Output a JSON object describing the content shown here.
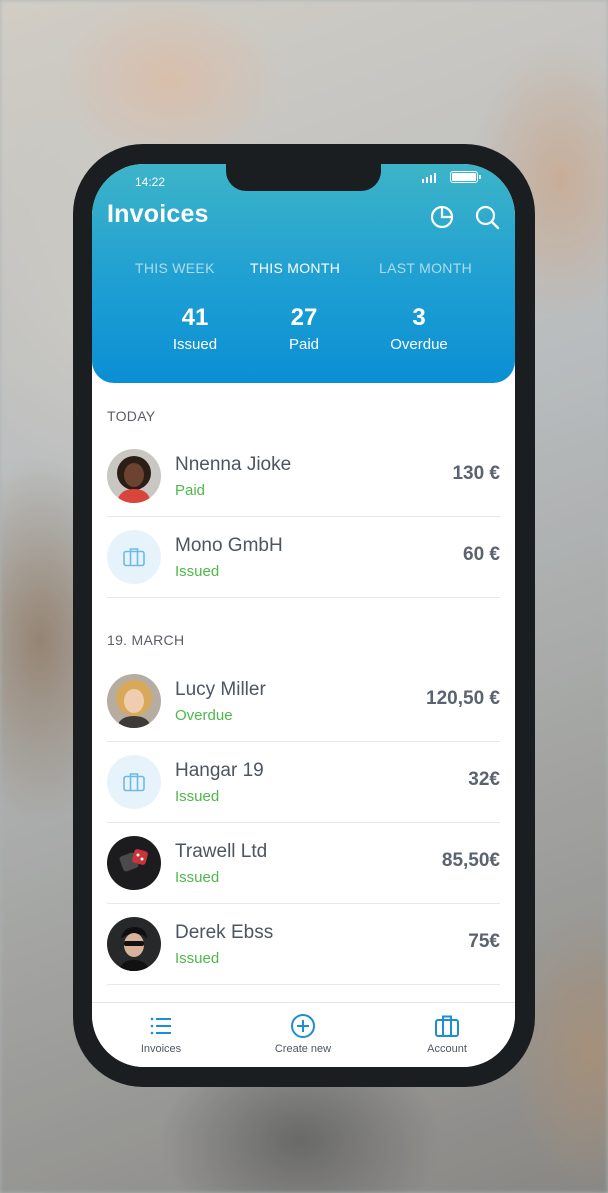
{
  "status_bar": {
    "time": "14:22"
  },
  "header": {
    "title": "Invoices",
    "tabs": [
      {
        "label": "THIS WEEK",
        "active": false
      },
      {
        "label": "THIS MONTH",
        "active": true
      },
      {
        "label": "LAST MONTH",
        "active": false
      }
    ],
    "stats": [
      {
        "value": "41",
        "label": "Issued"
      },
      {
        "value": "27",
        "label": "Paid"
      },
      {
        "value": "3",
        "label": "Overdue"
      }
    ]
  },
  "sections": [
    {
      "label": "TODAY",
      "items": [
        {
          "name": "Nnenna Jioke",
          "status": "Paid",
          "amount": "130 €",
          "avatar": "person-photo"
        },
        {
          "name": "Mono GmbH",
          "status": "Issued",
          "amount": "60 €",
          "avatar": "briefcase-icon"
        }
      ]
    },
    {
      "label": "19. MARCH",
      "items": [
        {
          "name": "Lucy Miller",
          "status": "Overdue",
          "amount": "120,50 €",
          "avatar": "person-photo"
        },
        {
          "name": "Hangar 19",
          "status": "Issued",
          "amount": "32€",
          "avatar": "briefcase-icon"
        },
        {
          "name": "Trawell Ltd",
          "status": "Issued",
          "amount": "85,50€",
          "avatar": "dice-photo"
        },
        {
          "name": "Derek Ebss",
          "status": "Issued",
          "amount": "75€",
          "avatar": "person-photo"
        }
      ]
    }
  ],
  "tab_bar": [
    {
      "label": "Invoices",
      "icon": "list-icon"
    },
    {
      "label": "Create new",
      "icon": "plus-circle-icon"
    },
    {
      "label": "Account",
      "icon": "briefcase-icon"
    }
  ],
  "colors": {
    "header_gradient_top": "#3db4c8",
    "header_gradient_bottom": "#0a8fd3",
    "status_green": "#4db94a",
    "accent_blue": "#1a8fd1",
    "text_dark": "#4d5560"
  }
}
